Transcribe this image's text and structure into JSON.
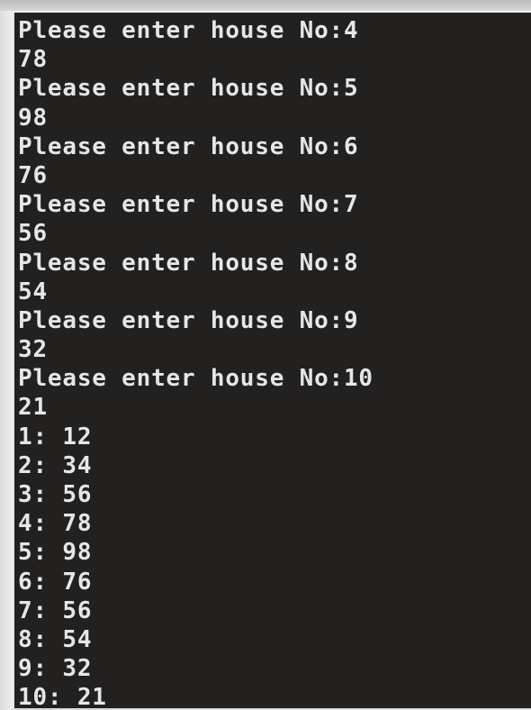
{
  "console": {
    "lines": [
      "Please enter house No:4",
      "78",
      "Please enter house No:5",
      "98",
      "Please enter house No:6",
      "76",
      "Please enter house No:7",
      "56",
      "Please enter house No:8",
      "54",
      "Please enter house No:9",
      "32",
      "Please enter house No:10",
      "21",
      "1: 12",
      "2: 34",
      "3: 56",
      "4: 78",
      "5: 98",
      "6: 76",
      "7: 56",
      "8: 54",
      "9: 32",
      "10: 21"
    ]
  },
  "colors": {
    "background": "#232020",
    "text": "#e6e6e6",
    "frame": "#d9d9d9"
  }
}
